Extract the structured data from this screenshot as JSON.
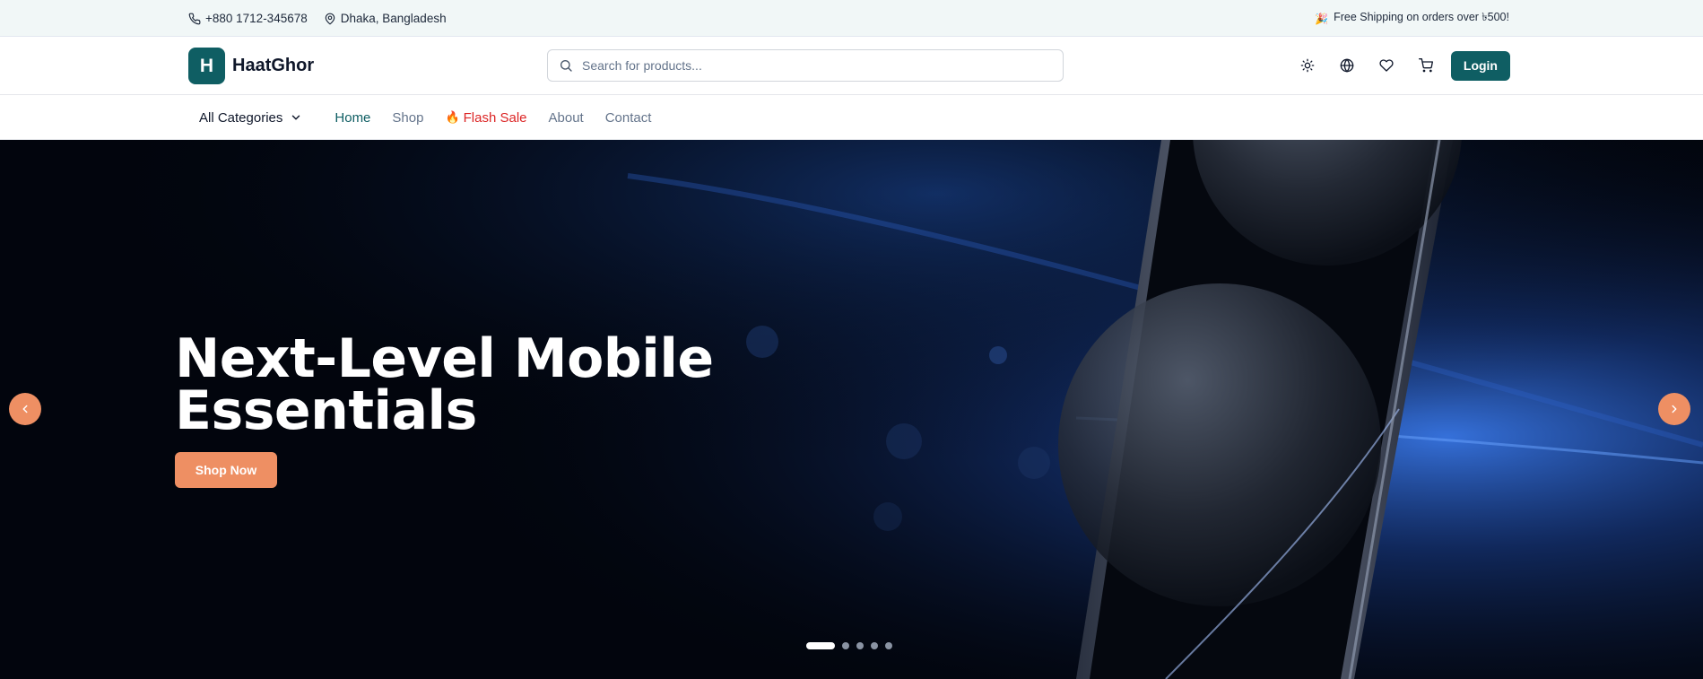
{
  "topbar": {
    "phone": "+880 1712-345678",
    "location": "Dhaka, Bangladesh",
    "shipping_note": "Free Shipping on orders over ৳500!"
  },
  "header": {
    "logo_letter": "H",
    "brand_name": "HaatGhor",
    "search_placeholder": "Search for products...",
    "login_label": "Login"
  },
  "nav": {
    "categories_label": "All Categories",
    "links": [
      {
        "label": "Home",
        "active": true
      },
      {
        "label": "Shop",
        "active": false
      },
      {
        "label": "Flash Sale",
        "active": false
      },
      {
        "label": "About",
        "active": false
      },
      {
        "label": "Contact",
        "active": false
      }
    ]
  },
  "hero": {
    "title": "Next-Level Mobile Essentials",
    "cta_label": "Shop Now",
    "slide_count": 5,
    "active_slide": 1
  },
  "colors": {
    "brand": "#0f5e63",
    "accent": "#ee8f63",
    "flash": "#dc2626"
  },
  "icons": [
    "phone-icon",
    "map-pin-icon",
    "party-icon",
    "search-icon",
    "sun-icon",
    "globe-icon",
    "heart-icon",
    "cart-icon",
    "chevron-down-icon",
    "flame-icon",
    "chevron-left-icon",
    "chevron-right-icon"
  ]
}
